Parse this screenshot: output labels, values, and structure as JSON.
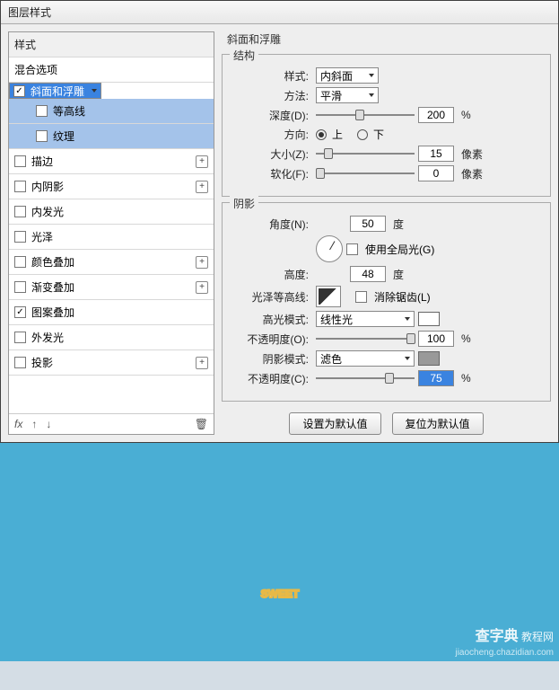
{
  "title": "图层样式",
  "sidebar": {
    "header": "样式",
    "blend": "混合选项",
    "items": [
      {
        "label": "斜面和浮雕",
        "checked": true,
        "selected": true,
        "plus": false
      },
      {
        "sub": true,
        "label": "等高线",
        "checked": false
      },
      {
        "sub": true,
        "label": "纹理",
        "checked": false
      },
      {
        "label": "描边",
        "checked": false,
        "plus": true
      },
      {
        "label": "内阴影",
        "checked": false,
        "plus": true
      },
      {
        "label": "内发光",
        "checked": false,
        "plus": false
      },
      {
        "label": "光泽",
        "checked": false,
        "plus": false
      },
      {
        "label": "颜色叠加",
        "checked": false,
        "plus": true
      },
      {
        "label": "渐变叠加",
        "checked": false,
        "plus": true
      },
      {
        "label": "图案叠加",
        "checked": true,
        "plus": false
      },
      {
        "label": "外发光",
        "checked": false,
        "plus": false
      },
      {
        "label": "投影",
        "checked": false,
        "plus": true
      }
    ],
    "fx": "fx"
  },
  "panel_title": "斜面和浮雕",
  "structure": {
    "title": "结构",
    "style_label": "样式:",
    "style_value": "内斜面",
    "method_label": "方法:",
    "method_value": "平滑",
    "depth_label": "深度(D):",
    "depth_value": "200",
    "depth_unit": "%",
    "dir_label": "方向:",
    "up": "上",
    "down": "下",
    "size_label": "大小(Z):",
    "size_value": "15",
    "size_unit": "像素",
    "soften_label": "软化(F):",
    "soften_value": "0",
    "soften_unit": "像素"
  },
  "shading": {
    "title": "阴影",
    "angle_label": "角度(N):",
    "angle_value": "50",
    "angle_unit": "度",
    "global_label": "使用全局光(G)",
    "alt_label": "高度:",
    "alt_value": "48",
    "alt_unit": "度",
    "gloss_label": "光泽等高线:",
    "anti_label": "消除锯齿(L)",
    "hmode_label": "高光模式:",
    "hmode_value": "线性光",
    "hopacity_label": "不透明度(O):",
    "hopacity_value": "100",
    "hopacity_unit": "%",
    "smode_label": "阴影模式:",
    "smode_value": "滤色",
    "sopacity_label": "不透明度(C):",
    "sopacity_value": "75",
    "sopacity_unit": "%"
  },
  "buttons": {
    "default": "设置为默认值",
    "reset": "复位为默认值"
  },
  "preview": {
    "text": "SWEET"
  },
  "watermark": {
    "brand": "查字典",
    "sub": "教程网",
    "url": "jiaocheng.chazidian.com"
  }
}
